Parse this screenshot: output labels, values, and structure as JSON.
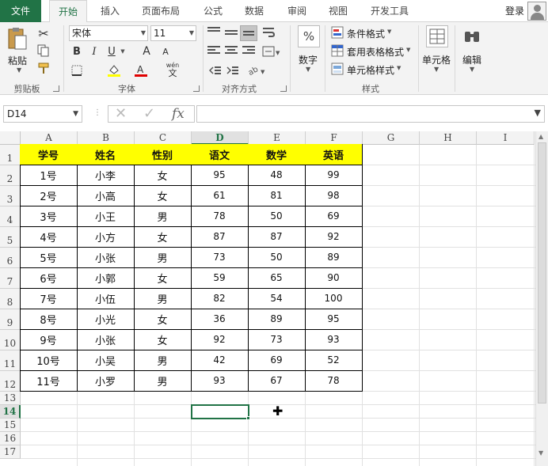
{
  "tabs": {
    "file": "文件",
    "home": "开始",
    "insert": "插入",
    "page_layout": "页面布局",
    "formulas": "公式",
    "data": "数据",
    "review": "审阅",
    "view": "视图",
    "developer": "开发工具",
    "login": "登录"
  },
  "ribbon": {
    "clipboard": {
      "paste": "粘贴",
      "label": "剪贴板"
    },
    "font": {
      "family": "宋体",
      "size": "11",
      "bold": "B",
      "italic": "I",
      "underline": "U",
      "grow": "A",
      "shrink": "A",
      "label": "字体",
      "phonetic_top": "wén",
      "phonetic": "文"
    },
    "alignment": {
      "label": "对齐方式"
    },
    "number": {
      "percent": "%",
      "label": "数字"
    },
    "styles": {
      "conditional": "条件格式",
      "table": "套用表格格式",
      "cell_styles": "单元格样式",
      "label": "样式"
    },
    "cells": {
      "label": "单元格"
    },
    "editing": {
      "label": "编辑"
    }
  },
  "formula_bar": {
    "name_box": "D14",
    "cancel": "✕",
    "confirm": "✓",
    "fx": "fx",
    "formula": ""
  },
  "columns": [
    "A",
    "B",
    "C",
    "D",
    "E",
    "F",
    "G",
    "H",
    "I"
  ],
  "rows": [
    "1",
    "2",
    "3",
    "4",
    "5",
    "6",
    "7",
    "8",
    "9",
    "10",
    "11",
    "12",
    "13",
    "14",
    "15",
    "16",
    "17"
  ],
  "selected_cell": {
    "column": "D",
    "row": "14"
  },
  "table": {
    "headers": [
      "学号",
      "姓名",
      "性别",
      "语文",
      "数学",
      "英语"
    ],
    "rows": [
      [
        "1号",
        "小李",
        "女",
        "95",
        "48",
        "99"
      ],
      [
        "2号",
        "小高",
        "女",
        "61",
        "81",
        "98"
      ],
      [
        "3号",
        "小王",
        "男",
        "78",
        "50",
        "69"
      ],
      [
        "4号",
        "小方",
        "女",
        "87",
        "87",
        "92"
      ],
      [
        "5号",
        "小张",
        "男",
        "73",
        "50",
        "89"
      ],
      [
        "6号",
        "小郭",
        "女",
        "59",
        "65",
        "90"
      ],
      [
        "7号",
        "小伍",
        "男",
        "82",
        "54",
        "100"
      ],
      [
        "8号",
        "小光",
        "女",
        "36",
        "89",
        "95"
      ],
      [
        "9号",
        "小张",
        "女",
        "92",
        "73",
        "93"
      ],
      [
        "10号",
        "小吴",
        "男",
        "42",
        "69",
        "52"
      ],
      [
        "11号",
        "小罗",
        "男",
        "93",
        "67",
        "78"
      ]
    ]
  },
  "colors": {
    "accent": "#217346",
    "header_fill": "#ffff00"
  }
}
